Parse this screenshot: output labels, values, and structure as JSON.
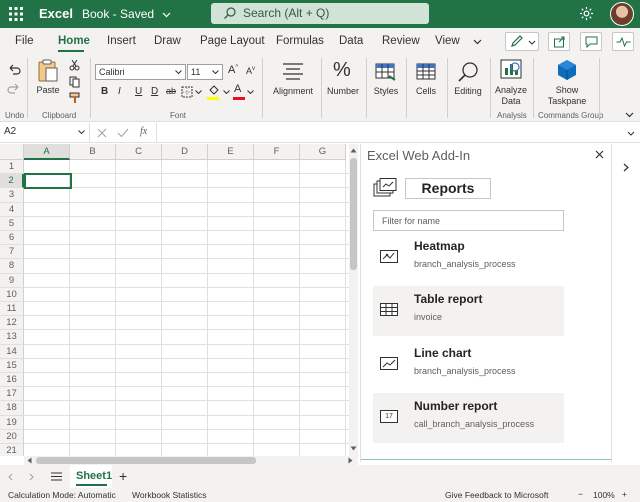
{
  "titlebar": {
    "app_name": "Excel",
    "document": "Book - Saved",
    "search_placeholder": "Search (Alt + Q)"
  },
  "menu": {
    "tabs": [
      "File",
      "Home",
      "Insert",
      "Draw",
      "Page Layout",
      "Formulas",
      "Data",
      "Review",
      "View"
    ],
    "active_tab": "Home"
  },
  "ribbon": {
    "groups": {
      "undo": "Undo",
      "clipboard": "Clipboard",
      "font": "Font",
      "analysis": "Analysis",
      "commands": "Commands Group"
    },
    "paste_label": "Paste",
    "font_name": "Calibri",
    "font_size": "11",
    "bold": "B",
    "italic": "I",
    "underline": "U",
    "double_underline": "D",
    "strike": "ab",
    "grow_font": "A",
    "shrink_font": "A",
    "font_color_letter": "A",
    "alignment_label": "Alignment",
    "number_label": "Number",
    "styles_label": "Styles",
    "cells_label": "Cells",
    "editing_label": "Editing",
    "analyze_data_line1": "Analyze",
    "analyze_data_line2": "Data",
    "show_taskpane_line1": "Show",
    "show_taskpane_line2": "Taskpane"
  },
  "formula_bar": {
    "name_box": "A2",
    "fx": "fx"
  },
  "grid": {
    "columns": [
      "A",
      "B",
      "C",
      "D",
      "E",
      "F",
      "G"
    ],
    "rows": [
      "1",
      "2",
      "3",
      "4",
      "5",
      "6",
      "7",
      "8",
      "9",
      "10",
      "11",
      "12",
      "13",
      "14",
      "15",
      "16",
      "17",
      "18",
      "19",
      "20",
      "21"
    ],
    "selected_cell": "A2"
  },
  "addin": {
    "title": "Excel Web Add-In",
    "reports_button": "Reports",
    "filter_placeholder": "Filter for name",
    "cards": [
      {
        "title": "Heatmap",
        "subtitle": "branch_analysis_process",
        "icon": "heatmap-icon"
      },
      {
        "title": "Table report",
        "subtitle": "invoice",
        "icon": "table-icon"
      },
      {
        "title": "Line chart",
        "subtitle": "branch_analysis_process",
        "icon": "line-chart-icon"
      },
      {
        "title": "Number report",
        "subtitle": "call_branch_analysis_process",
        "icon": "number-icon"
      }
    ],
    "number_icon_text": "17"
  },
  "sheets": {
    "active": "Sheet1",
    "add": "+"
  },
  "status": {
    "calc_mode": "Calculation Mode: Automatic",
    "workbook_stats": "Workbook Statistics",
    "feedback": "Give Feedback to Microsoft",
    "zoom_minus": "−",
    "zoom": "100%",
    "zoom_plus": "+"
  },
  "colors": {
    "brand": "#217346",
    "ribbon_bg": "#f3f2f1",
    "grid_line": "#e1dfdd"
  }
}
